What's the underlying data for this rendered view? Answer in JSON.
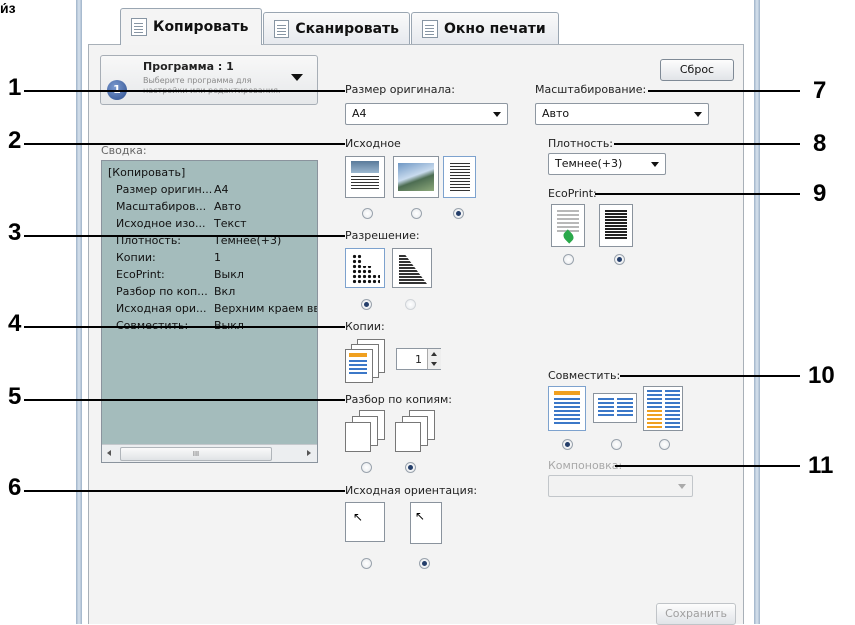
{
  "partial_top_text": "и́з",
  "tabs": [
    {
      "label": "Копировать",
      "active": true
    },
    {
      "label": "Сканировать",
      "active": false
    },
    {
      "label": "Окно печати",
      "active": false
    }
  ],
  "program": {
    "title": "Программа : 1",
    "number": "1",
    "hint_line1": "Выберите программа для",
    "hint_line2": "настройки или редактирования."
  },
  "summary": {
    "heading": "Сводка:",
    "group": "[Копировать]",
    "rows": [
      {
        "name": "Размер оригин...",
        "value": "A4"
      },
      {
        "name": "Масштабиров...",
        "value": "Авто"
      },
      {
        "name": "Исходное изо...",
        "value": "Текст"
      },
      {
        "name": "Плотность:",
        "value": "Темнее(+3)"
      },
      {
        "name": "Копии:",
        "value": "1"
      },
      {
        "name": "EcoPrint:",
        "value": "Выкл"
      },
      {
        "name": "Разбор по коп...",
        "value": "Вкл"
      },
      {
        "name": "Исходная ори...",
        "value": "Верхним краем ввер"
      },
      {
        "name": "Совместить:",
        "value": "Выкл"
      }
    ],
    "scroll_mark": "III"
  },
  "middle": {
    "original_size_label": "Размер оригинала:",
    "original_size_value": "A4",
    "original_image_label": "Исходное",
    "resolution_label": "Разрешение:",
    "copies_label": "Копии:",
    "copies_value": "1",
    "collate_label": "Разбор по копиям:",
    "orientation_label": "Исходная ориентация:"
  },
  "right": {
    "reset_label": "Сброс",
    "zoom_label": "Масштабирование:",
    "zoom_value": "Авто",
    "density_label": "Плотность:",
    "density_value": "Темнее(+3)",
    "ecoprint_label": "EcoPrint:",
    "combine_label": "Совместить:",
    "layout_label": "Компоновка:",
    "save_label": "Сохранить"
  },
  "callouts": [
    "1",
    "2",
    "3",
    "4",
    "5",
    "6",
    "7",
    "8",
    "9",
    "10",
    "11"
  ],
  "colors": {
    "summary_bg": "#a4bcbc",
    "accent_blue": "#3c78c8",
    "highlight_orange": "#f0a020",
    "eco_green": "#2aa84a"
  }
}
